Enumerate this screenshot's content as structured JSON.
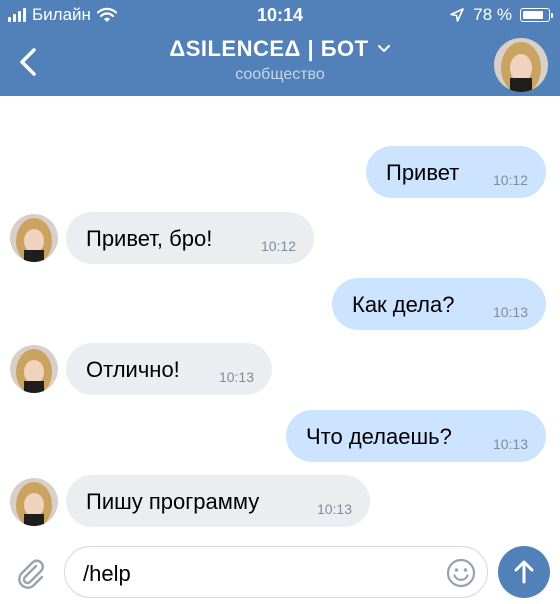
{
  "status_bar": {
    "carrier": "Билайн",
    "time": "10:14",
    "battery": "78 %",
    "battery_level": 0.78
  },
  "header": {
    "title": "ΔSILENCEΔ | БОТ",
    "subtitle": "сообщество"
  },
  "messages": [
    {
      "direction": "out",
      "text": "Привет",
      "time": "10:12"
    },
    {
      "direction": "in",
      "text": "Привет, бро!",
      "time": "10:12"
    },
    {
      "direction": "out",
      "text": "Как дела?",
      "time": "10:13"
    },
    {
      "direction": "in",
      "text": "Отлично!",
      "time": "10:13"
    },
    {
      "direction": "out",
      "text": "Что делаешь?",
      "time": "10:13"
    },
    {
      "direction": "in",
      "text": "Пишу программу",
      "time": "10:13"
    }
  ],
  "composer": {
    "value": "/help"
  },
  "colors": {
    "header": "#5181b8",
    "outgoing_bubble": "#cce4ff",
    "incoming_bubble": "#ebedf0",
    "send_button": "#5181b8"
  },
  "icons": {
    "back": "chevron-left-icon",
    "dropdown": "chevron-down-icon",
    "attach": "paperclip-icon",
    "emoji": "smiley-icon",
    "send": "arrow-up-icon"
  }
}
